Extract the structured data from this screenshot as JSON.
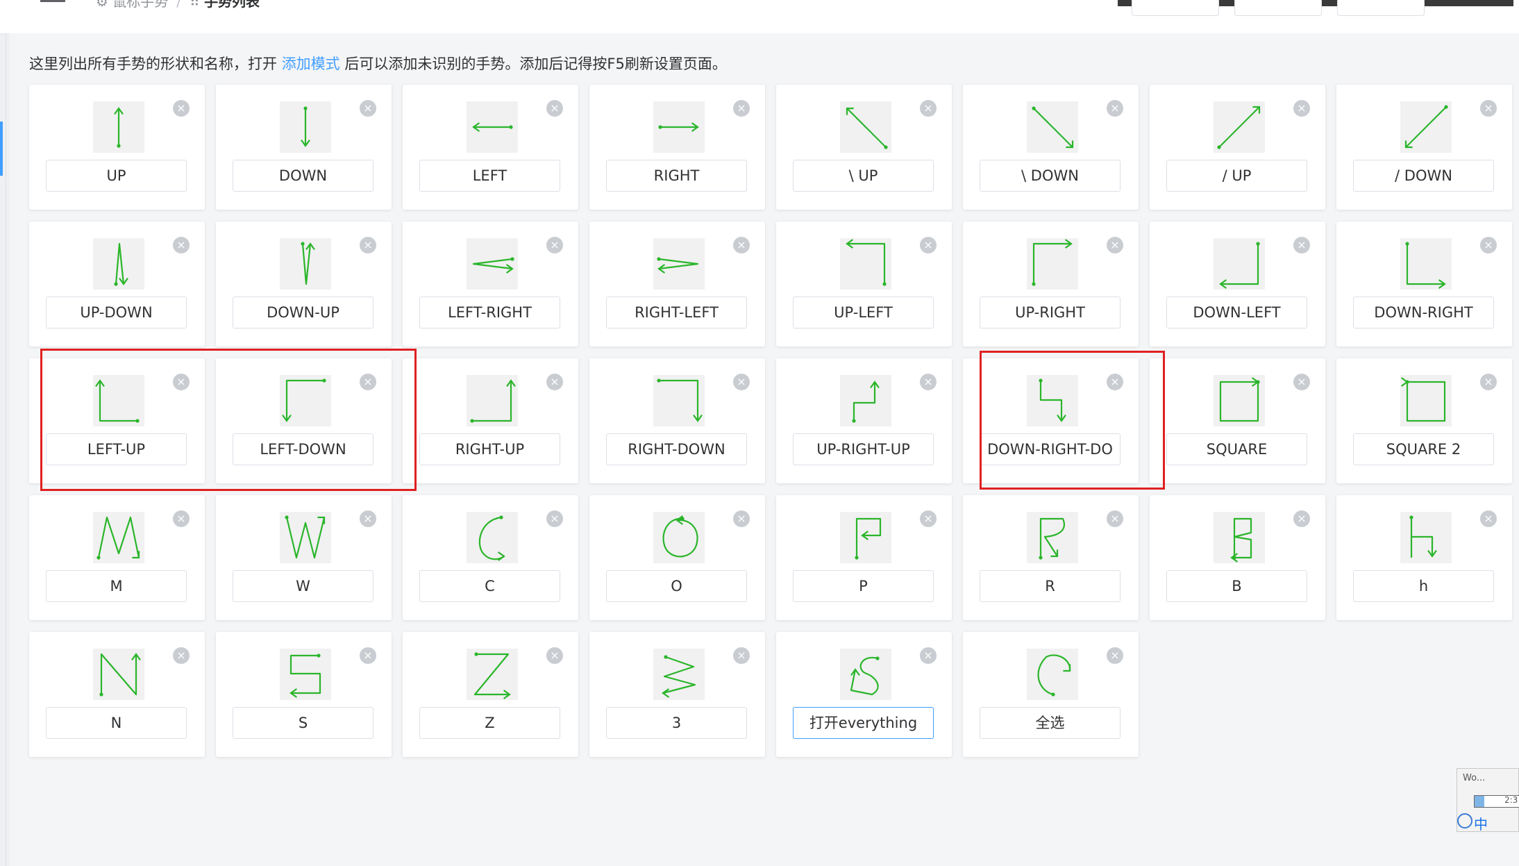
{
  "header": {
    "breadcrumb_parent": "鼠标手势",
    "breadcrumb_current": "手势列表",
    "breadcrumb_sep": "/"
  },
  "intro": {
    "text_before": "这里列出所有手势的形状和名称，打开",
    "link": "添加模式",
    "text_after": "后可以添加未识别的手势。添加后记得按F5刷新设置页面。"
  },
  "delete_glyph": "×",
  "stroke_color": "#2ab52a",
  "gestures": [
    {
      "name": "UP",
      "shape": "up"
    },
    {
      "name": "DOWN",
      "shape": "down"
    },
    {
      "name": "LEFT",
      "shape": "left"
    },
    {
      "name": "RIGHT",
      "shape": "right"
    },
    {
      "name": "\\ UP",
      "shape": "bs-up"
    },
    {
      "name": "\\ DOWN",
      "shape": "bs-down"
    },
    {
      "name": "/ UP",
      "shape": "sl-up"
    },
    {
      "name": "/ DOWN",
      "shape": "sl-down"
    },
    {
      "name": "UP-DOWN",
      "shape": "up-down"
    },
    {
      "name": "DOWN-UP",
      "shape": "down-up"
    },
    {
      "name": "LEFT-RIGHT",
      "shape": "left-right"
    },
    {
      "name": "RIGHT-LEFT",
      "shape": "right-left"
    },
    {
      "name": "UP-LEFT",
      "shape": "up-left"
    },
    {
      "name": "UP-RIGHT",
      "shape": "up-right"
    },
    {
      "name": "DOWN-LEFT",
      "shape": "down-left"
    },
    {
      "name": "DOWN-RIGHT",
      "shape": "down-right"
    },
    {
      "name": "LEFT-UP",
      "shape": "left-up"
    },
    {
      "name": "LEFT-DOWN",
      "shape": "left-down"
    },
    {
      "name": "RIGHT-UP",
      "shape": "right-up"
    },
    {
      "name": "RIGHT-DOWN",
      "shape": "right-down"
    },
    {
      "name": "UP-RIGHT-UP",
      "shape": "up-right-up"
    },
    {
      "name": "DOWN-RIGHT-DO",
      "shape": "down-right-down"
    },
    {
      "name": "SQUARE",
      "shape": "square"
    },
    {
      "name": "SQUARE 2",
      "shape": "square2"
    },
    {
      "name": "M",
      "shape": "m"
    },
    {
      "name": "W",
      "shape": "w"
    },
    {
      "name": "C",
      "shape": "c"
    },
    {
      "name": "O",
      "shape": "o"
    },
    {
      "name": "P",
      "shape": "p"
    },
    {
      "name": "R",
      "shape": "r"
    },
    {
      "name": "B",
      "shape": "b"
    },
    {
      "name": "h",
      "shape": "h"
    },
    {
      "name": "N",
      "shape": "n"
    },
    {
      "name": "S",
      "shape": "s"
    },
    {
      "name": "Z",
      "shape": "z"
    },
    {
      "name": "3",
      "shape": "three"
    },
    {
      "name": "打开everything",
      "shape": "everything",
      "focused": true
    },
    {
      "name": "全选",
      "shape": "select-all"
    }
  ],
  "tray": {
    "title": "Wo...",
    "value": "2:3",
    "ime": "中"
  }
}
